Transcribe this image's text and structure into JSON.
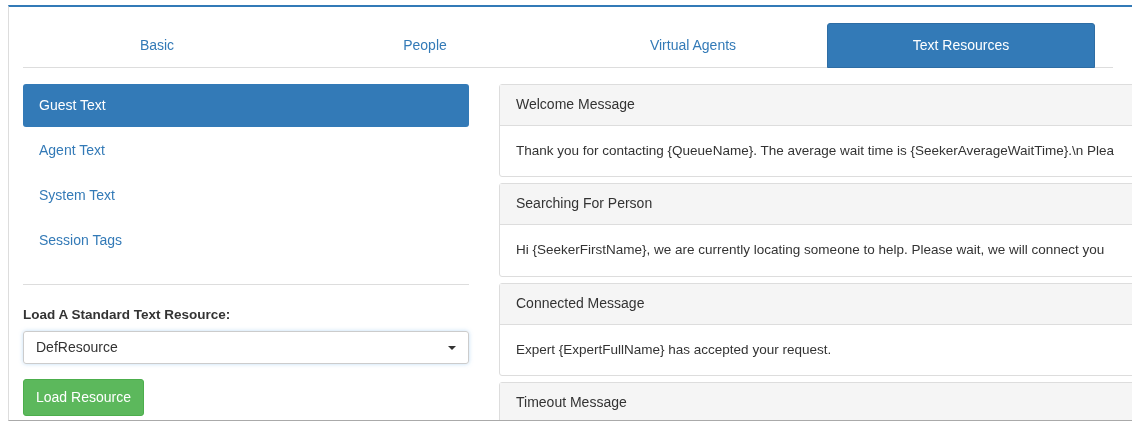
{
  "tabs": [
    {
      "label": "Basic",
      "selected": false
    },
    {
      "label": "People",
      "selected": false
    },
    {
      "label": "Virtual Agents",
      "selected": false
    },
    {
      "label": "Text Resources",
      "selected": true
    }
  ],
  "sidebar": {
    "items": [
      {
        "label": "Guest Text",
        "selected": true
      },
      {
        "label": "Agent Text",
        "selected": false
      },
      {
        "label": "System Text",
        "selected": false
      },
      {
        "label": "Session Tags",
        "selected": false
      }
    ]
  },
  "load_form": {
    "label": "Load A Standard Text Resource:",
    "select_value": "DefResource",
    "button": "Load Resource"
  },
  "panels": [
    {
      "heading": "Welcome Message",
      "body": "Thank you for contacting {QueueName}. The average wait time is {SeekerAverageWaitTime}.\\n Plea"
    },
    {
      "heading": "Searching For Person",
      "body": "Hi {SeekerFirstName}, we are currently locating someone to help. Please wait, we will connect you"
    },
    {
      "heading": "Connected Message",
      "body": "Expert {ExpertFullName} has accepted your request."
    },
    {
      "heading": "Timeout Message"
    }
  ]
}
